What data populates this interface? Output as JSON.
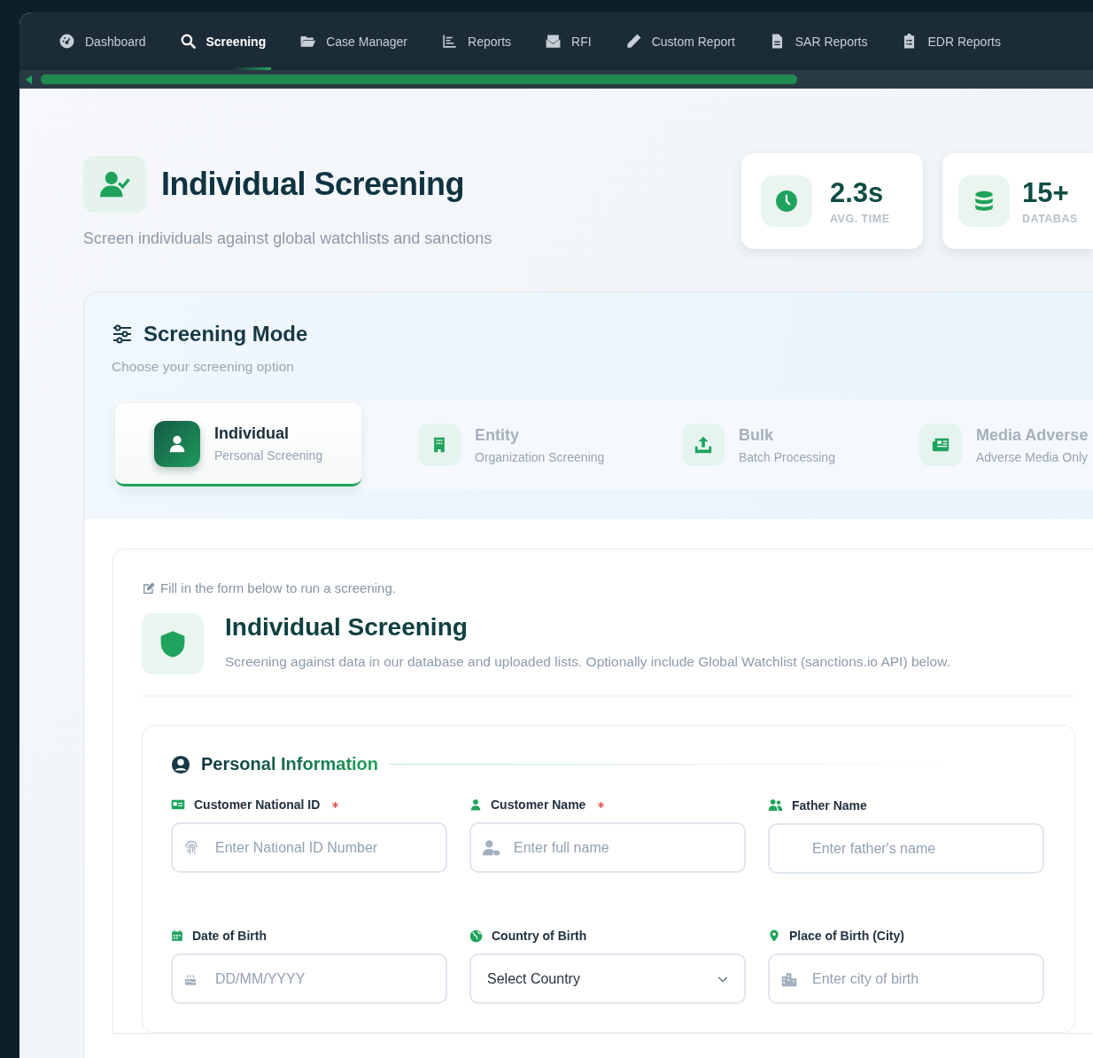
{
  "nav": {
    "tabs": [
      {
        "label": "Dashboard",
        "selected": false
      },
      {
        "label": "Screening",
        "selected": true
      },
      {
        "label": "Case Manager",
        "selected": false
      },
      {
        "label": "Reports",
        "selected": false
      },
      {
        "label": "RFI",
        "selected": false
      },
      {
        "label": "Custom Report",
        "selected": false
      },
      {
        "label": "SAR Reports",
        "selected": false
      },
      {
        "label": "EDR Reports",
        "selected": false
      }
    ]
  },
  "header": {
    "title": "Individual Screening",
    "subtitle": "Screen individuals against global watchlists and sanctions",
    "stats": [
      {
        "value": "2.3s",
        "label": "AVG. TIME"
      },
      {
        "value": "15+",
        "label": "DATABAS"
      }
    ]
  },
  "screening_mode": {
    "title": "Screening Mode",
    "subtitle": "Choose your screening option",
    "options": [
      {
        "title": "Individual",
        "subtitle": "Personal Screening",
        "selected": true
      },
      {
        "title": "Entity",
        "subtitle": "Organization Screening",
        "selected": false
      },
      {
        "title": "Bulk",
        "subtitle": "Batch Processing",
        "selected": false
      },
      {
        "title": "Media Adverse",
        "subtitle": "Adverse Media Only",
        "selected": false
      }
    ]
  },
  "form": {
    "hint": "Fill in the form below to run a screening.",
    "title": "Individual Screening",
    "description": "Screening against data in our database and uploaded lists. Optionally include Global Watchlist (sanctions.io API) below.",
    "section": {
      "title": "Personal Information",
      "fields": [
        {
          "kind": "text",
          "label": "Customer National ID",
          "required": true,
          "placeholder": "Enter National ID Number"
        },
        {
          "kind": "text",
          "label": "Customer Name",
          "required": true,
          "placeholder": "Enter full name"
        },
        {
          "kind": "text",
          "label": "Father Name",
          "required": false,
          "placeholder": "Enter father's name"
        },
        {
          "kind": "text",
          "label": "Date of Birth",
          "required": false,
          "placeholder": "DD/MM/YYYY"
        },
        {
          "kind": "select",
          "label": "Country of Birth",
          "required": false,
          "value": "Select Country"
        },
        {
          "kind": "text",
          "label": "Place of Birth (City)",
          "required": false,
          "placeholder": "Enter city of birth"
        }
      ]
    }
  }
}
